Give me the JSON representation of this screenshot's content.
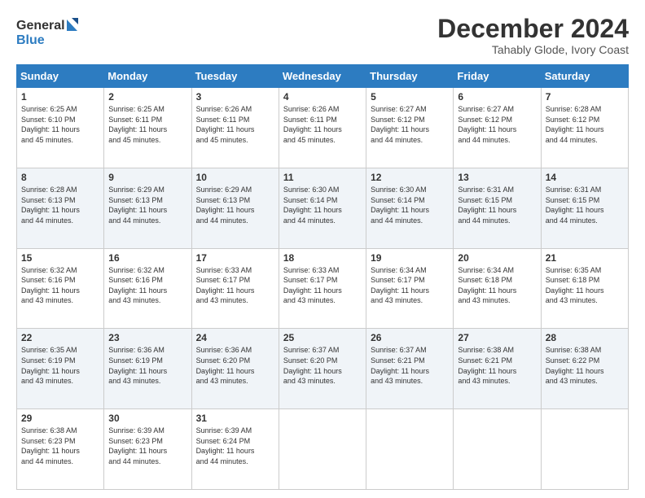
{
  "logo": {
    "line1": "General",
    "line2": "Blue"
  },
  "title": "December 2024",
  "subtitle": "Tahably Glode, Ivory Coast",
  "days_header": [
    "Sunday",
    "Monday",
    "Tuesday",
    "Wednesday",
    "Thursday",
    "Friday",
    "Saturday"
  ],
  "weeks": [
    [
      {
        "day": "1",
        "info": "Sunrise: 6:25 AM\nSunset: 6:10 PM\nDaylight: 11 hours\nand 45 minutes."
      },
      {
        "day": "2",
        "info": "Sunrise: 6:25 AM\nSunset: 6:11 PM\nDaylight: 11 hours\nand 45 minutes."
      },
      {
        "day": "3",
        "info": "Sunrise: 6:26 AM\nSunset: 6:11 PM\nDaylight: 11 hours\nand 45 minutes."
      },
      {
        "day": "4",
        "info": "Sunrise: 6:26 AM\nSunset: 6:11 PM\nDaylight: 11 hours\nand 45 minutes."
      },
      {
        "day": "5",
        "info": "Sunrise: 6:27 AM\nSunset: 6:12 PM\nDaylight: 11 hours\nand 44 minutes."
      },
      {
        "day": "6",
        "info": "Sunrise: 6:27 AM\nSunset: 6:12 PM\nDaylight: 11 hours\nand 44 minutes."
      },
      {
        "day": "7",
        "info": "Sunrise: 6:28 AM\nSunset: 6:12 PM\nDaylight: 11 hours\nand 44 minutes."
      }
    ],
    [
      {
        "day": "8",
        "info": "Sunrise: 6:28 AM\nSunset: 6:13 PM\nDaylight: 11 hours\nand 44 minutes."
      },
      {
        "day": "9",
        "info": "Sunrise: 6:29 AM\nSunset: 6:13 PM\nDaylight: 11 hours\nand 44 minutes."
      },
      {
        "day": "10",
        "info": "Sunrise: 6:29 AM\nSunset: 6:13 PM\nDaylight: 11 hours\nand 44 minutes."
      },
      {
        "day": "11",
        "info": "Sunrise: 6:30 AM\nSunset: 6:14 PM\nDaylight: 11 hours\nand 44 minutes."
      },
      {
        "day": "12",
        "info": "Sunrise: 6:30 AM\nSunset: 6:14 PM\nDaylight: 11 hours\nand 44 minutes."
      },
      {
        "day": "13",
        "info": "Sunrise: 6:31 AM\nSunset: 6:15 PM\nDaylight: 11 hours\nand 44 minutes."
      },
      {
        "day": "14",
        "info": "Sunrise: 6:31 AM\nSunset: 6:15 PM\nDaylight: 11 hours\nand 44 minutes."
      }
    ],
    [
      {
        "day": "15",
        "info": "Sunrise: 6:32 AM\nSunset: 6:16 PM\nDaylight: 11 hours\nand 43 minutes."
      },
      {
        "day": "16",
        "info": "Sunrise: 6:32 AM\nSunset: 6:16 PM\nDaylight: 11 hours\nand 43 minutes."
      },
      {
        "day": "17",
        "info": "Sunrise: 6:33 AM\nSunset: 6:17 PM\nDaylight: 11 hours\nand 43 minutes."
      },
      {
        "day": "18",
        "info": "Sunrise: 6:33 AM\nSunset: 6:17 PM\nDaylight: 11 hours\nand 43 minutes."
      },
      {
        "day": "19",
        "info": "Sunrise: 6:34 AM\nSunset: 6:17 PM\nDaylight: 11 hours\nand 43 minutes."
      },
      {
        "day": "20",
        "info": "Sunrise: 6:34 AM\nSunset: 6:18 PM\nDaylight: 11 hours\nand 43 minutes."
      },
      {
        "day": "21",
        "info": "Sunrise: 6:35 AM\nSunset: 6:18 PM\nDaylight: 11 hours\nand 43 minutes."
      }
    ],
    [
      {
        "day": "22",
        "info": "Sunrise: 6:35 AM\nSunset: 6:19 PM\nDaylight: 11 hours\nand 43 minutes."
      },
      {
        "day": "23",
        "info": "Sunrise: 6:36 AM\nSunset: 6:19 PM\nDaylight: 11 hours\nand 43 minutes."
      },
      {
        "day": "24",
        "info": "Sunrise: 6:36 AM\nSunset: 6:20 PM\nDaylight: 11 hours\nand 43 minutes."
      },
      {
        "day": "25",
        "info": "Sunrise: 6:37 AM\nSunset: 6:20 PM\nDaylight: 11 hours\nand 43 minutes."
      },
      {
        "day": "26",
        "info": "Sunrise: 6:37 AM\nSunset: 6:21 PM\nDaylight: 11 hours\nand 43 minutes."
      },
      {
        "day": "27",
        "info": "Sunrise: 6:38 AM\nSunset: 6:21 PM\nDaylight: 11 hours\nand 43 minutes."
      },
      {
        "day": "28",
        "info": "Sunrise: 6:38 AM\nSunset: 6:22 PM\nDaylight: 11 hours\nand 43 minutes."
      }
    ],
    [
      {
        "day": "29",
        "info": "Sunrise: 6:38 AM\nSunset: 6:23 PM\nDaylight: 11 hours\nand 44 minutes."
      },
      {
        "day": "30",
        "info": "Sunrise: 6:39 AM\nSunset: 6:23 PM\nDaylight: 11 hours\nand 44 minutes."
      },
      {
        "day": "31",
        "info": "Sunrise: 6:39 AM\nSunset: 6:24 PM\nDaylight: 11 hours\nand 44 minutes."
      },
      null,
      null,
      null,
      null
    ]
  ]
}
